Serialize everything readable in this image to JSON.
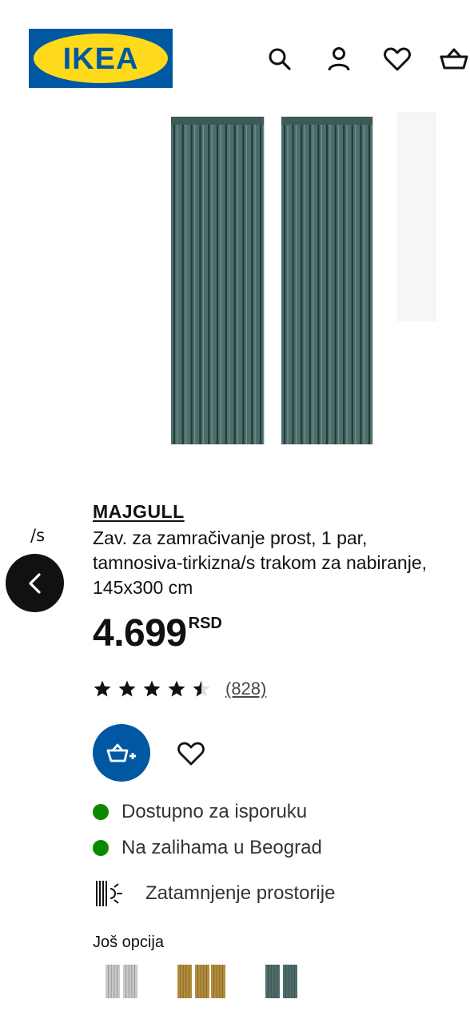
{
  "header": {
    "logo_text": "IKEA",
    "icons": [
      "search-icon",
      "profile-icon",
      "heart-icon",
      "cart-icon"
    ]
  },
  "gallery": {
    "peek_text": "/s"
  },
  "product": {
    "name": "MAJGULL",
    "description": "Zav. za zamračivanje prost, 1 par, tamnosiva-tirkizna/s trakom za nabiranje, 145x300 cm",
    "price": "4.699",
    "currency": "RSD",
    "rating": 4.5,
    "review_count": "(828)"
  },
  "availability": [
    {
      "text": "Dostupno za isporuku",
      "color": "#0a8a00"
    },
    {
      "text": "Na zalihama u Beograd",
      "color": "#0a8a00"
    }
  ],
  "feature": {
    "icon": "blackout-icon",
    "text": "Zatamnjenje prostorije"
  },
  "more_options": {
    "title": "Još opcija",
    "swatches": [
      {
        "name": "light-grey",
        "color": "#c9c9c9"
      },
      {
        "name": "golden-brown",
        "color": "#b38d3c"
      },
      {
        "name": "grey-turquoise",
        "color": "#4f6d6b"
      }
    ]
  },
  "colors": {
    "brand_blue": "#0058a3",
    "brand_yellow": "#ffda1a",
    "curtain": "#4c6e6b"
  }
}
